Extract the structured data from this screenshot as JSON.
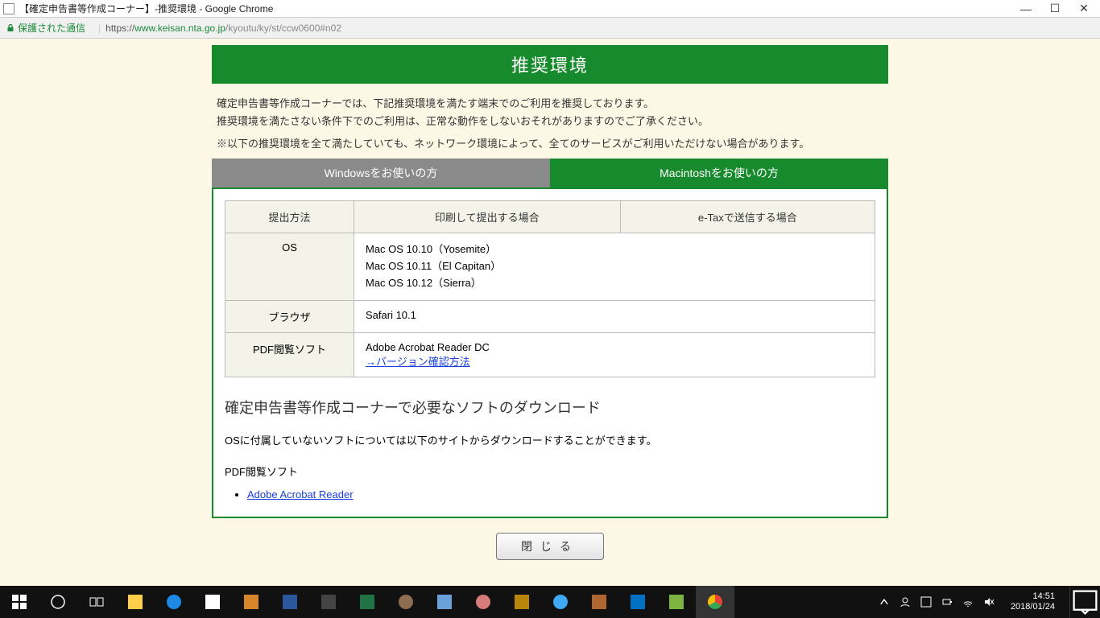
{
  "window": {
    "title": "【確定申告書等作成コーナー】-推奨環境 - Google Chrome"
  },
  "address": {
    "secure_label": "保護された通信",
    "url_prefix": "https://",
    "url_host": "www.keisan.nta.go.jp",
    "url_path": "/kyoutu/ky/st/ccw0600#n02"
  },
  "page": {
    "banner": "推奨環境",
    "intro_line1": "確定申告書等作成コーナーでは、下記推奨環境を満たす端末でのご利用を推奨しております。",
    "intro_line2": "推奨環境を満たさない条件下でのご利用は、正常な動作をしないおそれがありますのでご了承ください。",
    "note": "※以下の推奨環境を全て満たしていても、ネットワーク環境によって、全てのサービスがご利用いただけない場合があります。",
    "tabs": {
      "windows": "Windowsをお使いの方",
      "mac": "Macintoshをお使いの方"
    },
    "table": {
      "col_method": "提出方法",
      "col_print": "印刷して提出する場合",
      "col_etax": "e-Taxで送信する場合",
      "row_os_label": "OS",
      "row_os_val1": "Mac OS 10.10（Yosemite）",
      "row_os_val2": "Mac OS 10.11（El Capitan）",
      "row_os_val3": "Mac OS 10.12（Sierra）",
      "row_browser_label": "ブラウザ",
      "row_browser_val": "Safari 10.1",
      "row_pdf_label": "PDF閲覧ソフト",
      "row_pdf_val": "Adobe Acrobat Reader DC",
      "row_pdf_link": "→バージョン確認方法"
    },
    "download": {
      "heading": "確定申告書等作成コーナーで必要なソフトのダウンロード",
      "text": "OSに付属していないソフトについては以下のサイトからダウンロードすることができます。",
      "sub": "PDF閲覧ソフト",
      "link": "Adobe Acrobat Reader"
    },
    "close_button": "閉じる"
  },
  "taskbar": {
    "time": "14:51",
    "date": "2018/01/24"
  }
}
